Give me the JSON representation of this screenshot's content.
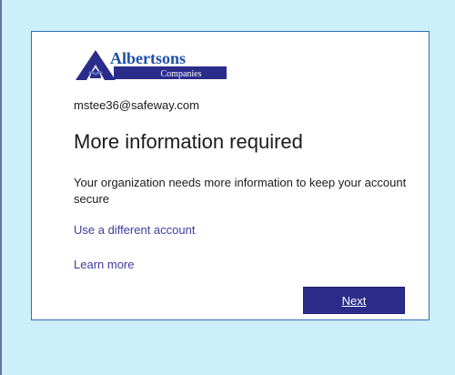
{
  "brand": {
    "name": "Albertsons",
    "subtitle": "Companies",
    "color_primary": "#2b2c8a",
    "color_blue": "#1f4fa8"
  },
  "account": {
    "email": "mstee36@safeway.com"
  },
  "content": {
    "title": "More information required",
    "description": "Your organization needs more information to keep your account secure"
  },
  "links": {
    "different_account": "Use a different account",
    "learn_more": "Learn more"
  },
  "actions": {
    "next_label": "Next"
  },
  "colors": {
    "page_background": "#cdeefb",
    "card_border": "#2f6fb8",
    "link": "#3e3ca0",
    "button": "#2b2c8a"
  }
}
